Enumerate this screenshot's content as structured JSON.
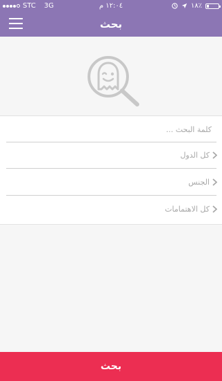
{
  "status_bar": {
    "carrier": "STC",
    "network": "3G",
    "time": "١٢:٠٤ م",
    "battery_percent": "١٨٪"
  },
  "nav": {
    "title": "بحث",
    "menu_icon": "hamburger-menu-icon"
  },
  "logo": {
    "icon": "ghost-search-logo-icon"
  },
  "form": {
    "search_placeholder": "كلمة البحث ...",
    "search_value": "",
    "countries_label": "كل الدول",
    "gender_label": "الجنس",
    "interests_label": "كل الاهتمامات",
    "chevron_icon": "chevron-right-icon"
  },
  "footer": {
    "search_button_label": "بحث"
  },
  "colors": {
    "header": "#8c76b4",
    "button": "#ec2e52",
    "background": "#f6f6f6"
  }
}
